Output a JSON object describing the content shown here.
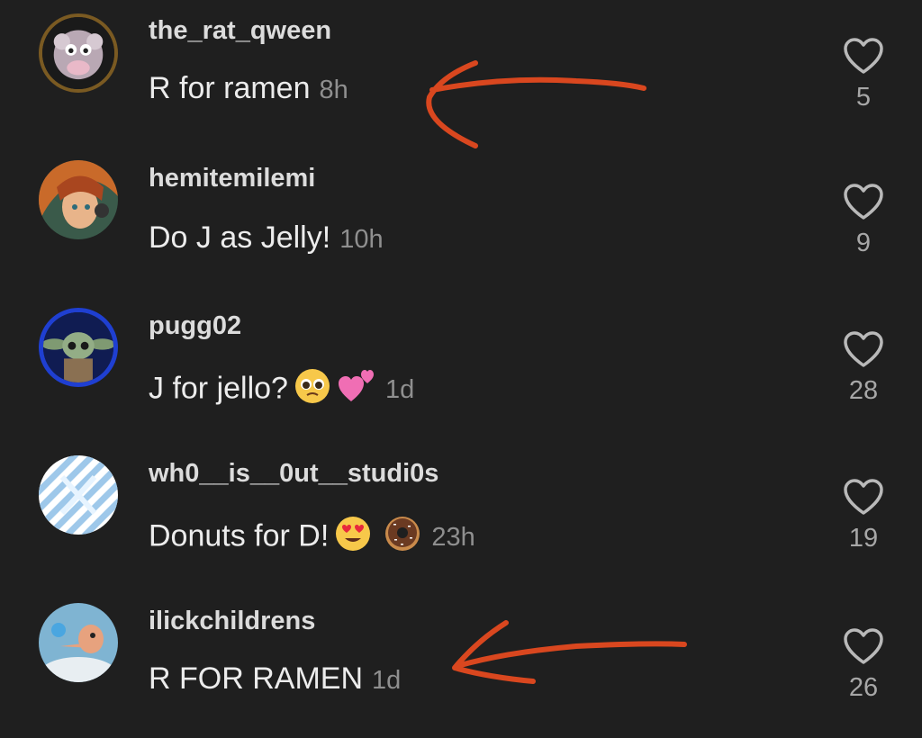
{
  "comments": [
    {
      "username": "the_rat_qween",
      "text": "R for ramen",
      "time": "8h",
      "likes": "5"
    },
    {
      "username": "hemitemilemi",
      "text": "Do J as Jelly!",
      "time": "10h",
      "likes": "9"
    },
    {
      "username": "pugg02",
      "text": "J for jello?",
      "emojis": [
        "pleading-face-emoji",
        "two-hearts-emoji"
      ],
      "time": "1d",
      "likes": "28"
    },
    {
      "username": "wh0__is__0ut__studi0s",
      "text": "Donuts for D!",
      "emojis": [
        "heart-eyes-emoji",
        "doughnut-emoji"
      ],
      "time": "23h",
      "likes": "19"
    },
    {
      "username": "ilickchildrens",
      "text": "R FOR RAMEN",
      "time": "1d",
      "likes": "26"
    }
  ],
  "colors": {
    "background": "#1f1f1f",
    "annotation": "#d9471f",
    "muted": "#8f8f8f"
  },
  "icons": {
    "like": "heart-outline-icon"
  }
}
